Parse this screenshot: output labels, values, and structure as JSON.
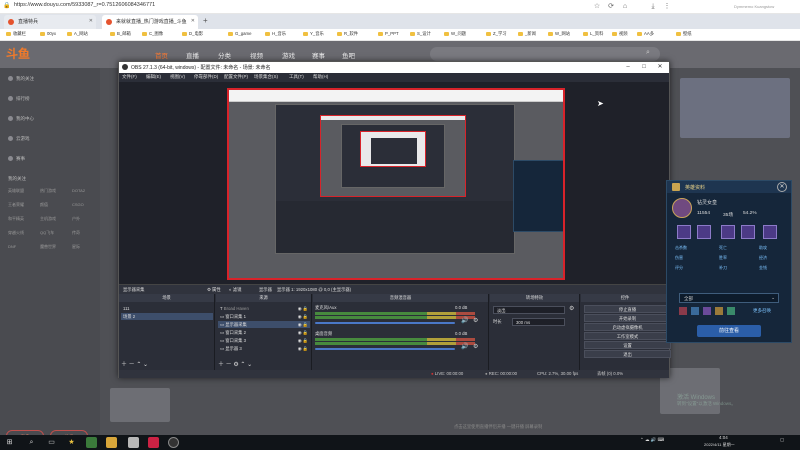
{
  "browser": {
    "url": "https://www.douyu.com/5933087_r=0.7512606084346771",
    "tabs": [
      {
        "label": "直播特兵"
      },
      {
        "label": "来就就直播_热门游戏直播_斗鱼"
      }
    ],
    "new_tab": "+",
    "user_text": "Dymmemo Kuangstow",
    "bookmarks": [
      "收藏栏",
      "00yx",
      "A_网站",
      "B_邮箱",
      "C_图像",
      "D_电影",
      "G_game",
      "H_音乐",
      "Y_音乐",
      "R_软件",
      "P_PPT",
      "S_设计",
      "W_问题",
      "Z_学习",
      "_新闻",
      "W_网站",
      "L_资料",
      "视频",
      "AA多",
      "壁纸"
    ]
  },
  "douyu": {
    "logo": "斗鱼",
    "nav": [
      "首页",
      "直播",
      "分类",
      "视频",
      "游戏",
      "赛事",
      "鱼吧"
    ],
    "side_items": [
      "我的关注",
      "排行榜",
      "我的中心",
      "云游戏",
      "赛事"
    ],
    "side_section": "我的关注",
    "side_tags": [
      "英雄联盟",
      "热门游戏",
      "DOTA2",
      "王者荣耀",
      "颜值",
      "CSGO",
      "和平精英",
      "主机游戏",
      "户外",
      "穿越火线",
      "QQ飞车",
      "传奇",
      "DNF",
      "魔兽世界",
      "星际"
    ],
    "side_btn_1": "更多",
    "side_btn_2": "分类"
  },
  "obs": {
    "title": "OBS 27.1.3 (64-bit, windows) - 配置文件: 未命名 - 场景: 未命名",
    "menu": [
      "文件(F)",
      "编辑(E)",
      "视图(V)",
      "停靠部件(D)",
      "配置文件(P)",
      "场景集合(S)",
      "工具(T)",
      "帮助(H)"
    ],
    "bottom_bar": {
      "left": "显示器采集",
      "props": "属性",
      "filters": "滤镜",
      "display": "显示器",
      "res": "显示器 1: 1920x1080 @ 0,0 (主显示器)"
    },
    "docks": {
      "scenes": {
        "title": "场景",
        "items": [
          "111",
          "场景 2"
        ]
      },
      "sources": {
        "title": "来源",
        "items": [
          "Broad Haven",
          "窗口采集 1",
          "显示器采集",
          "窗口采集 2",
          "窗口采集 3",
          "显示器 3"
        ]
      },
      "mixer": {
        "title": "音频混音器",
        "channels": [
          {
            "name": "麦克风/Aux",
            "db": "0.0 dB"
          },
          {
            "name": "桌面音频",
            "db": "0.0 dB"
          }
        ]
      },
      "transitions": {
        "title": "转场特效",
        "type": "淡出",
        "duration_label": "时长",
        "duration": "300 ms"
      },
      "controls": {
        "title": "控件",
        "buttons": [
          "停止直播",
          "开始录制",
          "启动虚拟摄像机",
          "工作室模式",
          "设置",
          "退出"
        ]
      }
    },
    "status": {
      "live": "LIVE: 00:00:00",
      "rec": "REC: 00:00:00",
      "cpu": "CPU: 2.7%, 30.00 fps",
      "drop": "丢帧 (0) 0.0%"
    }
  },
  "card": {
    "title": "英雄资料",
    "name": "钻灵女皇",
    "stats": [
      "11554",
      "35场",
      "54.2%"
    ],
    "small_labels": [
      "击杀数",
      "死亡",
      "助攻",
      "伤害",
      "胜率",
      "经济",
      "评分",
      "补刀",
      "金钱"
    ],
    "select": "全部",
    "link": "更多召唤",
    "button": "前往查看"
  },
  "taskbar": {
    "time": "4:04",
    "date": "2022/4/11 星期一",
    "banner": "点击这里使用直播伴侣开播 一键开播 屏幕录制",
    "watermark": "激活 Windows",
    "watermark2": "转到\"设置\"以激活 Windows。"
  },
  "colors": {
    "obs_red_border": "#d8232a",
    "douyu_orange": "#ff7a30",
    "obs_bg": "#2b2e38",
    "card_bg": "#15263a"
  }
}
